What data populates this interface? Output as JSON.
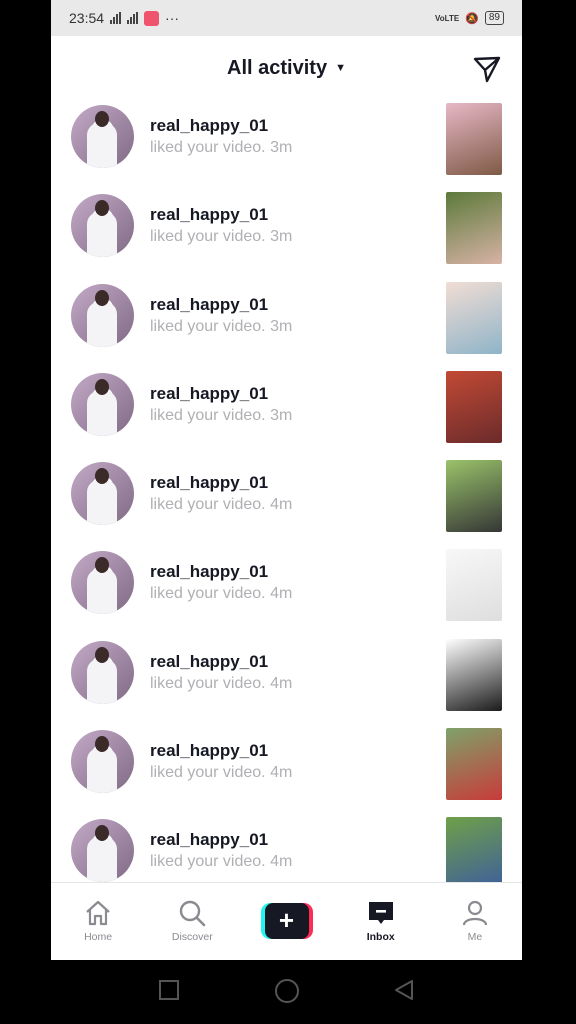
{
  "status_bar": {
    "time": "23:54",
    "battery": "89",
    "network_tag": "VoLTE"
  },
  "header": {
    "title": "All activity",
    "caret_icon": "caret-down-icon",
    "send_icon": "paper-plane-icon"
  },
  "notifications": [
    {
      "username": "real_happy_01",
      "action": "liked your video.",
      "time": "3m",
      "thumb": [
        "#e7b8c6",
        "#7f5a46"
      ]
    },
    {
      "username": "real_happy_01",
      "action": "liked your video.",
      "time": "3m",
      "thumb": [
        "#5c7a3a",
        "#d7b2a6"
      ]
    },
    {
      "username": "real_happy_01",
      "action": "liked your video.",
      "time": "3m",
      "thumb": [
        "#f1ddd4",
        "#8fb4c8"
      ]
    },
    {
      "username": "real_happy_01",
      "action": "liked your video.",
      "time": "3m",
      "thumb": [
        "#c24a35",
        "#6b2b2b"
      ]
    },
    {
      "username": "real_happy_01",
      "action": "liked your video.",
      "time": "4m",
      "thumb": [
        "#9ac36a",
        "#353636"
      ]
    },
    {
      "username": "real_happy_01",
      "action": "liked your video.",
      "time": "4m",
      "thumb": [
        "#f8f8f8",
        "#dedede"
      ]
    },
    {
      "username": "real_happy_01",
      "action": "liked your video.",
      "time": "4m",
      "thumb": [
        "#ffffff",
        "#1b1b1b"
      ]
    },
    {
      "username": "real_happy_01",
      "action": "liked your video.",
      "time": "4m",
      "thumb": [
        "#7ea26a",
        "#c83b3b"
      ]
    },
    {
      "username": "real_happy_01",
      "action": "liked your video.",
      "time": "4m",
      "thumb": [
        "#6fa048",
        "#3e5e9c"
      ]
    }
  ],
  "tabbar": {
    "tabs": [
      {
        "label": "Home",
        "icon": "home-icon"
      },
      {
        "label": "Discover",
        "icon": "search-icon"
      },
      {
        "label": "",
        "icon": "plus-icon"
      },
      {
        "label": "Inbox",
        "icon": "inbox-icon",
        "active": true
      },
      {
        "label": "Me",
        "icon": "profile-icon"
      }
    ]
  },
  "colors": {
    "text_primary": "#161823",
    "text_secondary": "#b0b0b4",
    "create_cyan": "#25f4ee",
    "create_red": "#fe2c55"
  }
}
